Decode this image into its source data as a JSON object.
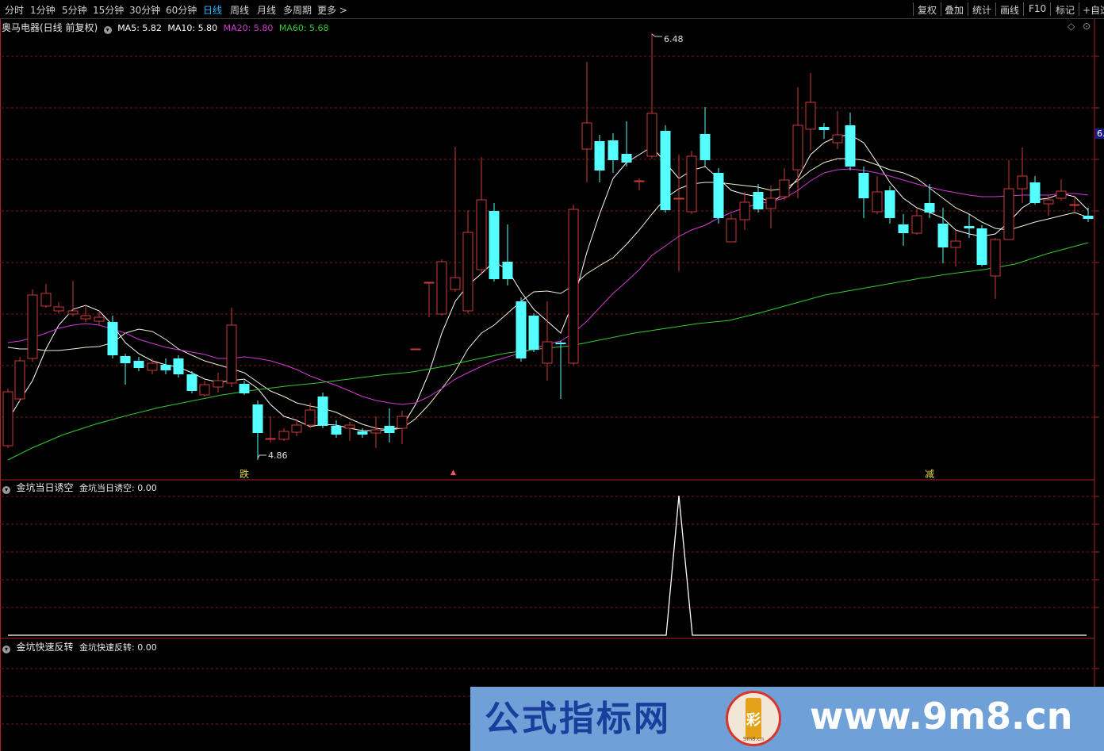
{
  "toolbar": {
    "tabs": [
      "分时",
      "1分钟",
      "5分钟",
      "15分钟",
      "30分钟",
      "60分钟",
      "日线",
      "周线",
      "月线",
      "多周期",
      "更多 >"
    ],
    "active_tab": "日线",
    "right_buttons": [
      "复权",
      "叠加",
      "统计",
      "画线",
      "F10",
      "标记",
      "+自选"
    ]
  },
  "main_panel": {
    "stock_title": "奥马电器(日线 前复权)",
    "ma_legend": [
      {
        "label": "MA5: 5.82",
        "color": "#ffffff"
      },
      {
        "label": "MA10: 5.80",
        "color": "#ffffff"
      },
      {
        "label": "MA20: 5.80",
        "color": "#d43bd4"
      },
      {
        "label": "MA60: 5.68",
        "color": "#33cc33"
      }
    ],
    "high_label": "6.48",
    "low_label": "4.86",
    "price_tag": "6.",
    "signal_marks": [
      "跌",
      "减"
    ]
  },
  "indicator_1": {
    "title": "金坑当日诱空",
    "value_label": "金坑当日诱空: 0.00"
  },
  "indicator_2": {
    "title": "金坑快速反转",
    "value_label": "金坑快速反转: 0.00"
  },
  "watermark": {
    "title": "公式指标网",
    "url": "www.9m8.cn",
    "logo_text": "9m8.cn"
  },
  "colors": {
    "up": "#d03a3a",
    "down": "#55ffff",
    "ma5": "#ffffff",
    "ma10": "#f0f0d0",
    "ma20": "#d43bd4",
    "ma60": "#33cc33",
    "grid": "#7a1c1c",
    "active_tab": "#22b8ff"
  },
  "chart_data": {
    "type": "candlestick",
    "low": 4.86,
    "high": 6.48,
    "last_ma": {
      "MA5": 5.82,
      "MA10": 5.8,
      "MA20": 5.8,
      "MA60": 5.68
    },
    "indicator_1_values": "0 on all days except one spike to 1"
  }
}
